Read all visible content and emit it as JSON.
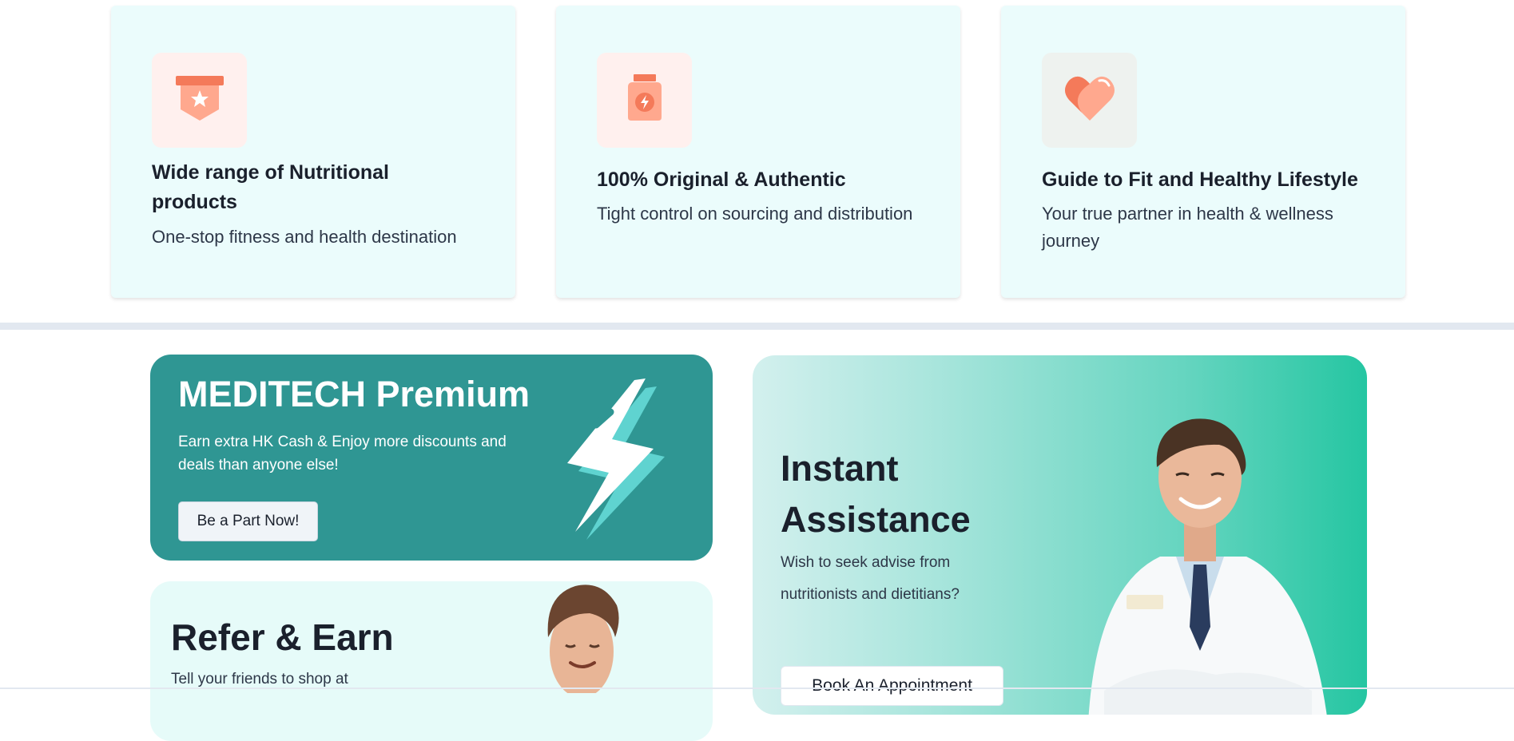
{
  "features": [
    {
      "title": "Wide range of Nutritional products",
      "description": "One-stop fitness and health destination",
      "icon": "shield-star-icon",
      "icon_bg": "#fff0ee"
    },
    {
      "title": "100% Original & Authentic",
      "description": "Tight control on sourcing and distribution",
      "icon": "supplement-jar-icon",
      "icon_bg": "#fff0ee"
    },
    {
      "title": "Guide to Fit and Healthy Lifestyle",
      "description": "Your true partner in health & wellness journey",
      "icon": "heart-icon",
      "icon_bg": "#eef2ef"
    }
  ],
  "premium": {
    "title": "MEDITECH Premium",
    "description": "Earn extra HK Cash & Enjoy more discounts and deals than anyone else!",
    "button_label": "Be a Part Now!",
    "bg_color": "#2f9693"
  },
  "refer": {
    "title": "Refer & Earn",
    "description": "Tell your friends to shop at"
  },
  "assistance": {
    "title": "Instant Assistance",
    "description": "Wish to seek advise from nutritionists and dietitians?",
    "button_label": "Book An Appointment"
  },
  "colors": {
    "accent_orange": "#f47a5a",
    "feature_card_bg": "#ebfcfc",
    "assist_gradient_end": "#25c6a2"
  }
}
